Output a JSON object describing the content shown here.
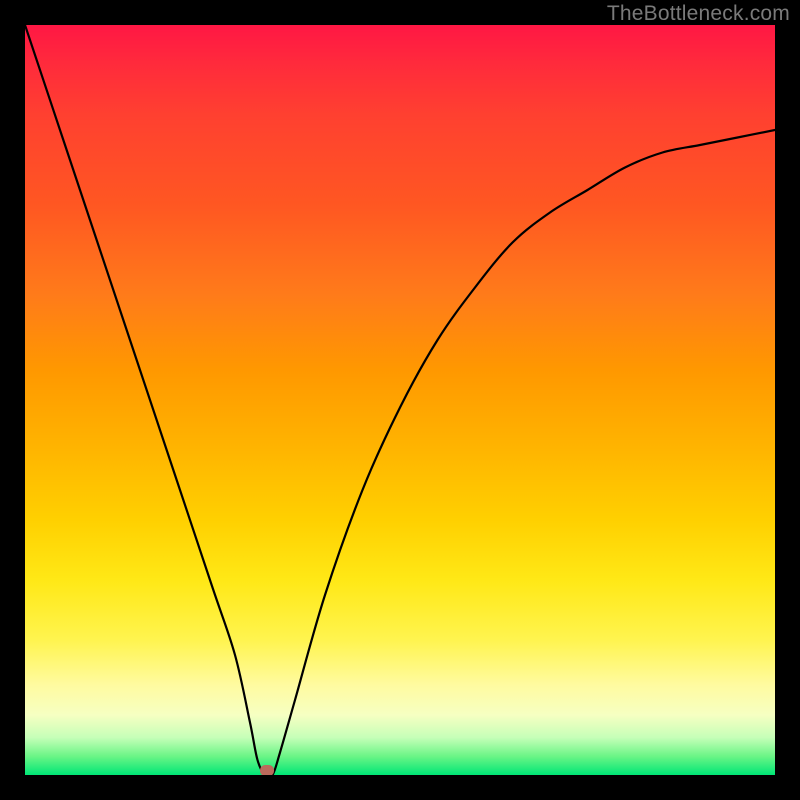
{
  "watermark": "TheBottleneck.com",
  "marker": {
    "x_frac": 0.323,
    "y_frac": 0.995
  },
  "chart_data": {
    "type": "line",
    "title": "",
    "xlabel": "",
    "ylabel": "",
    "xlim": [
      0,
      1
    ],
    "ylim": [
      0,
      1
    ],
    "grid": false,
    "legend": false,
    "annotations": [
      "TheBottleneck.com"
    ],
    "series": [
      {
        "name": "bottleneck-curve",
        "x": [
          0.0,
          0.05,
          0.1,
          0.15,
          0.2,
          0.25,
          0.28,
          0.3,
          0.31,
          0.32,
          0.33,
          0.34,
          0.36,
          0.4,
          0.45,
          0.5,
          0.55,
          0.6,
          0.65,
          0.7,
          0.75,
          0.8,
          0.85,
          0.9,
          0.95,
          1.0
        ],
        "y": [
          1.0,
          0.85,
          0.7,
          0.55,
          0.4,
          0.25,
          0.16,
          0.07,
          0.02,
          0.0,
          0.0,
          0.03,
          0.1,
          0.24,
          0.38,
          0.49,
          0.58,
          0.65,
          0.71,
          0.75,
          0.78,
          0.81,
          0.83,
          0.84,
          0.85,
          0.86
        ]
      }
    ],
    "background_gradient": {
      "direction": "top-to-bottom",
      "stops": [
        {
          "pos": 0.0,
          "color": "#ff1744"
        },
        {
          "pos": 0.25,
          "color": "#ff5722"
        },
        {
          "pos": 0.5,
          "color": "#ffb300"
        },
        {
          "pos": 0.75,
          "color": "#ffeb3b"
        },
        {
          "pos": 0.95,
          "color": "#d4ffb0"
        },
        {
          "pos": 1.0,
          "color": "#00e676"
        }
      ]
    }
  }
}
